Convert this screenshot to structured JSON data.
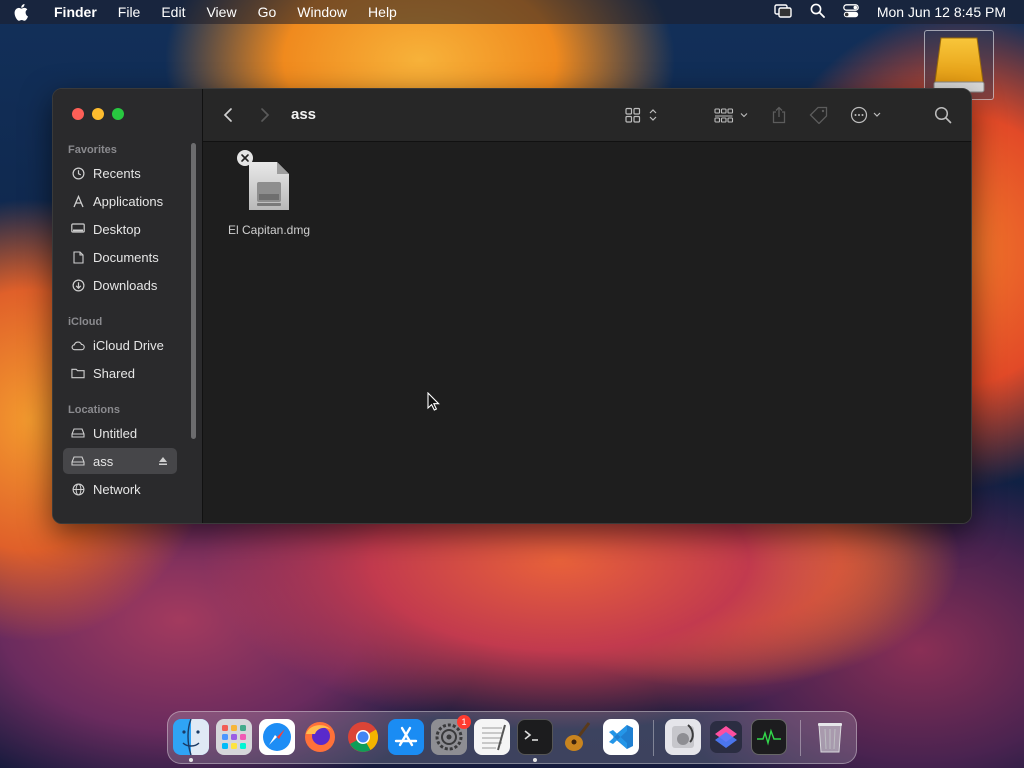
{
  "menubar": {
    "app_name": "Finder",
    "menus": [
      "File",
      "Edit",
      "View",
      "Go",
      "Window",
      "Help"
    ],
    "clock": "Mon Jun 12  8:45 PM"
  },
  "finder": {
    "title": "ass",
    "sidebar": {
      "favorites_header": "Favorites",
      "favorites": [
        {
          "label": "Recents",
          "icon": "clock-icon"
        },
        {
          "label": "Applications",
          "icon": "applications-icon"
        },
        {
          "label": "Desktop",
          "icon": "desktop-icon"
        },
        {
          "label": "Documents",
          "icon": "document-icon"
        },
        {
          "label": "Downloads",
          "icon": "download-icon"
        }
      ],
      "icloud_header": "iCloud",
      "icloud": [
        {
          "label": "iCloud Drive",
          "icon": "cloud-icon"
        },
        {
          "label": "Shared",
          "icon": "shared-folder-icon"
        }
      ],
      "locations_header": "Locations",
      "locations": [
        {
          "label": "Untitled",
          "icon": "drive-icon"
        },
        {
          "label": "ass",
          "icon": "drive-icon",
          "selected": true
        },
        {
          "label": "Network",
          "icon": "globe-icon"
        }
      ]
    },
    "files": [
      {
        "name": "El Capitan.dmg",
        "icon": "disk-image-icon"
      }
    ]
  },
  "dock": {
    "apps": [
      "Finder",
      "Launchpad",
      "Safari",
      "Firefox",
      "Chrome",
      "App Store",
      "System Settings",
      "TextEdit",
      "Terminal",
      "GarageBand",
      "Visual Studio Code",
      "Disk Utility",
      "Shortcuts",
      "Activity Monitor",
      "Trash"
    ],
    "settings_badge": "1"
  },
  "colors": {
    "close": "#fe5f57",
    "minimize": "#febc2e",
    "maximize": "#28c840",
    "sidebar_bg": "#2a2a2c",
    "content_bg": "#1e1e1e"
  }
}
